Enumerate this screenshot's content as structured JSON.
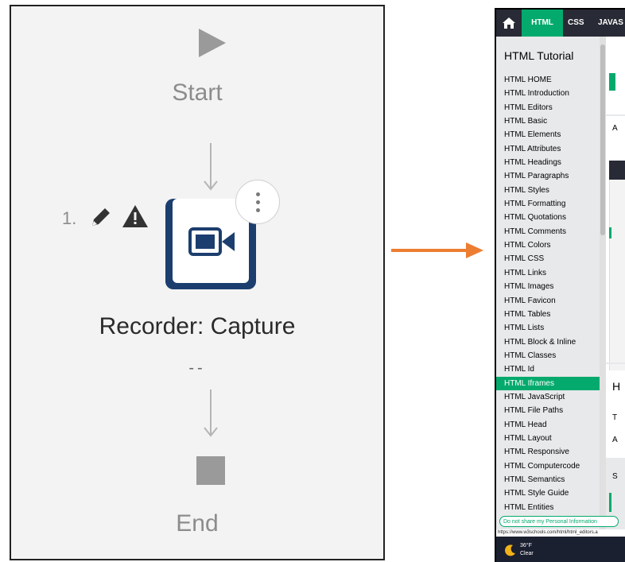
{
  "flow": {
    "start_label": "Start",
    "step_number": "1.",
    "action_title": "Recorder: Capture",
    "action_subtitle": "--",
    "end_label": "End"
  },
  "browser": {
    "nav": {
      "html": "HTML",
      "css": "CSS",
      "js": "JAVAS"
    },
    "sidebar_title": "HTML Tutorial",
    "sidebar_items": [
      "HTML HOME",
      "HTML Introduction",
      "HTML Editors",
      "HTML Basic",
      "HTML Elements",
      "HTML Attributes",
      "HTML Headings",
      "HTML Paragraphs",
      "HTML Styles",
      "HTML Formatting",
      "HTML Quotations",
      "HTML Comments",
      "HTML Colors",
      "HTML CSS",
      "HTML Links",
      "HTML Images",
      "HTML Favicon",
      "HTML Tables",
      "HTML Lists",
      "HTML Block & Inline",
      "HTML Classes",
      "HTML Id",
      "HTML Iframes",
      "HTML JavaScript",
      "HTML File Paths",
      "HTML Head",
      "HTML Layout",
      "HTML Responsive",
      "HTML Computercode",
      "HTML Semantics",
      "HTML Style Guide",
      "HTML Entities"
    ],
    "active_item": "HTML Iframes",
    "privacy_link": "Do not share my Personal Information",
    "status_url": "https://www.w3schools.com/html/html_editors.a",
    "weather_temp": "36°F",
    "weather_desc": "Clear"
  },
  "colors": {
    "w3_green": "#04aa6d",
    "w3_dark": "#282a35",
    "arrow_orange": "#ed7d31",
    "card_blue": "#1c3e6e"
  }
}
